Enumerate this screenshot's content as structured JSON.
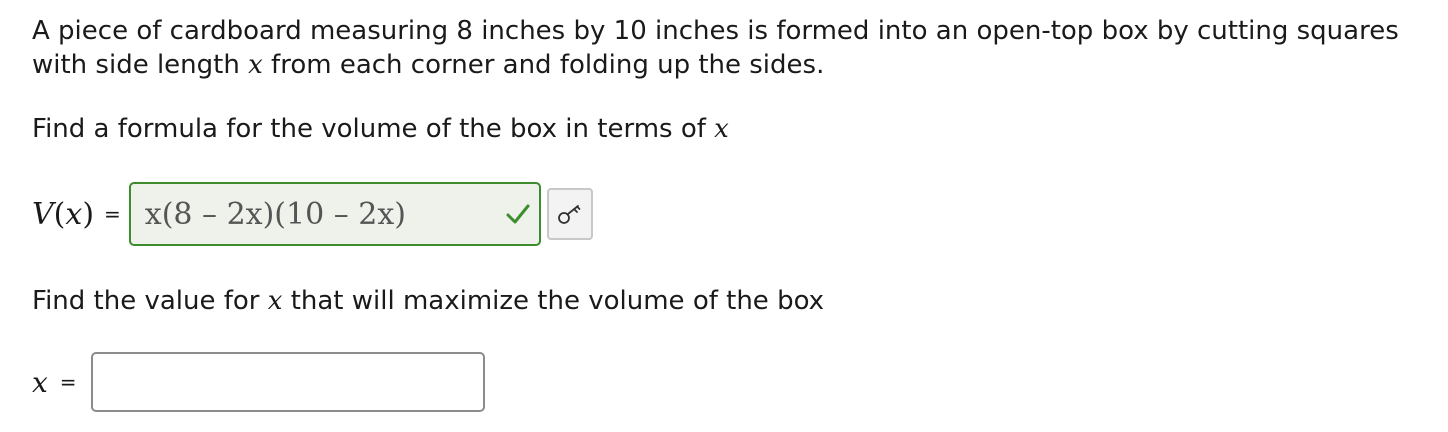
{
  "problem": {
    "statement_part1": "A piece of cardboard measuring 8 inches by 10 inches is formed into an open-top box by cutting squares",
    "statement_part2a": "with side length ",
    "variable": "x",
    "statement_part2b": " from each corner and folding up the sides."
  },
  "question1": {
    "text": "Find a formula for the volume of the box in terms of ",
    "variable": "x",
    "lhs_function": "V",
    "lhs_open": "(",
    "lhs_var": "x",
    "lhs_close": ")",
    "equals": "=",
    "answer": "x(8 – 2x)(10 – 2x)",
    "status_icon": "check-icon",
    "status_color": "#3d8c2e",
    "key_icon": "key-icon"
  },
  "question2": {
    "text": "Find the value for ",
    "variable": "x",
    "text_after": " that will maximize the volume of the box",
    "lhs_var": "x",
    "equals": "=",
    "input_value": ""
  }
}
